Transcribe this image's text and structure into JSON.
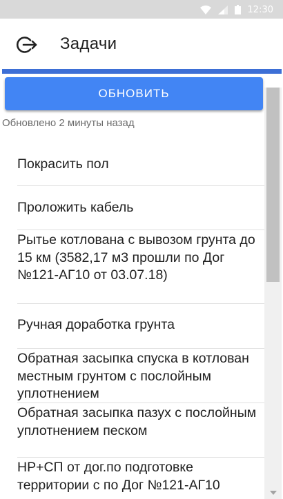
{
  "status_bar": {
    "time": "12:30",
    "icons": [
      "wifi-icon",
      "signal-icon",
      "battery-icon"
    ]
  },
  "app_bar": {
    "title": "Задачи",
    "back_icon": "logout-icon"
  },
  "refresh_button": {
    "label": "ОБНОВИТЬ"
  },
  "updated_text": "Обновлено 2 минуты назад",
  "tasks": [
    {
      "title": "Покрасить пол"
    },
    {
      "title": "Проложить кабель"
    },
    {
      "title": "Рытье котлована с вывозом грунта до 15 км (3582,17 м3 прошли по Дог №121-АГ10 от 03.07.18)"
    },
    {
      "title": "Ручная доработка грунта"
    },
    {
      "title": "Обратная засыпка спуска в котлован местным грунтом с послойным уплотнением"
    },
    {
      "title": "Обратная засыпка пазух с послойным уплотнением песком"
    },
    {
      "title": "НР+СП от дог.по подготовке территории с по Дог №121-АГ10"
    }
  ],
  "colors": {
    "accent": "#4285f4",
    "strip": "#3d6fd6",
    "status_bar": "#d9d9d9"
  }
}
